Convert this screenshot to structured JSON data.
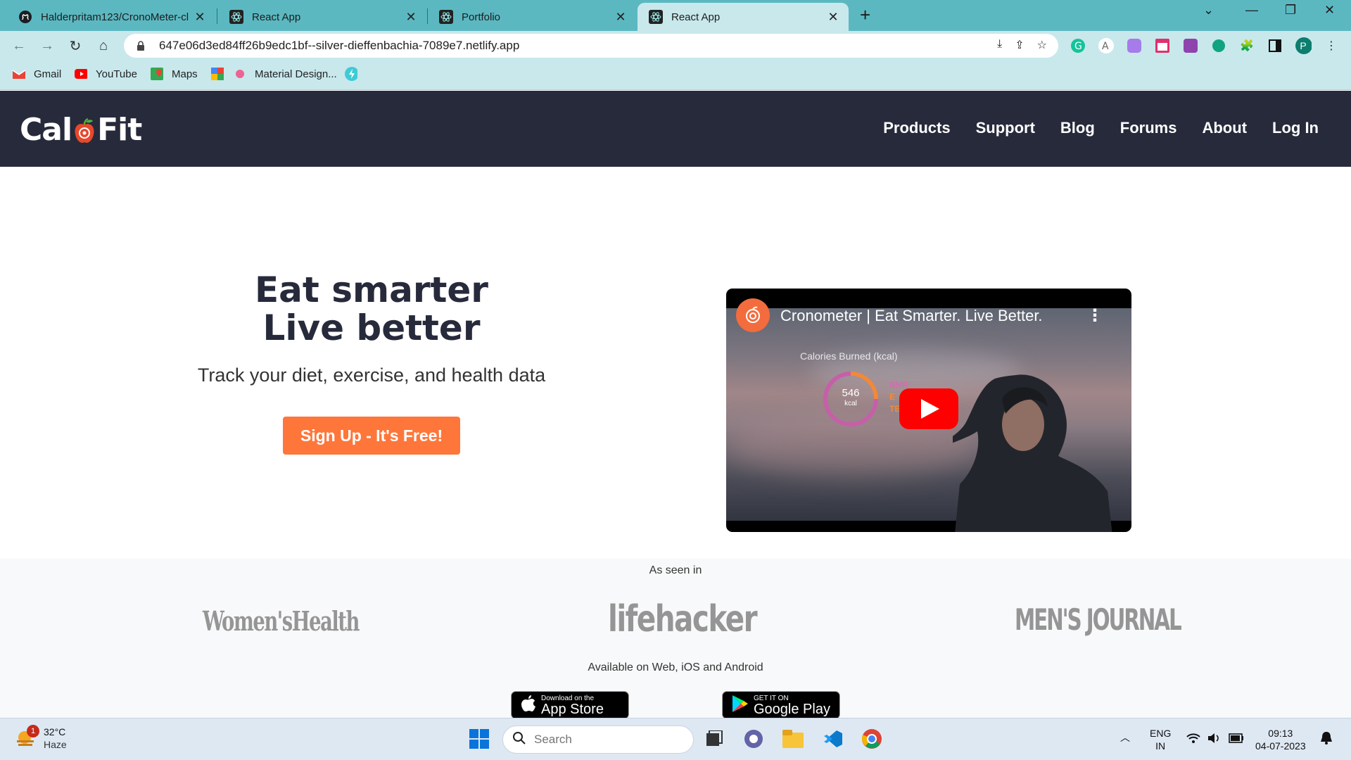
{
  "browser": {
    "tabs": [
      {
        "title": "Halderpritam123/CronoMeter-cl",
        "icon": "github-icon"
      },
      {
        "title": "React App",
        "icon": "react-icon"
      },
      {
        "title": "Portfolio",
        "icon": "github-icon"
      },
      {
        "title": "React App",
        "icon": "react-icon"
      }
    ],
    "new_tab_glyph": "+",
    "url": "647e06d3ed84ff26b9edc1bf--silver-dieffenbachia-7089e7.netlify.app",
    "profile_initial": "P",
    "bookmarks": [
      {
        "label": "Gmail",
        "icon": "gmail-icon"
      },
      {
        "label": "YouTube",
        "icon": "youtube-icon"
      },
      {
        "label": "Maps",
        "icon": "maps-icon"
      },
      {
        "label": "",
        "icon": "apps-icon"
      },
      {
        "label": "Material Design...",
        "icon": "material-design-icon"
      },
      {
        "label": "",
        "icon": "bolt-icon"
      }
    ]
  },
  "site": {
    "logo_left": "Cal",
    "logo_right": "Fit",
    "nav": [
      "Products",
      "Support",
      "Blog",
      "Forums",
      "About",
      "Log In"
    ]
  },
  "hero": {
    "title_line1": "Eat smarter",
    "title_line2": "Live better",
    "subtitle": "Track your diet, exercise, and health data",
    "cta": "Sign Up - It's Free!"
  },
  "video": {
    "title": "Cronometer | Eat Smarter. Live Better.",
    "overlay_label": "Calories Burned (kcal)",
    "kcal_value": "546",
    "kcal_unit": "kcal",
    "legend_bmr": "BMR",
    "legend_e": "E",
    "legend_te": "TE"
  },
  "press": {
    "label": "As seen in",
    "logos": [
      "Women'sHealth",
      "lifehacker",
      "MEN'S JOURNAL"
    ],
    "available": "Available on Web, iOS and Android",
    "app_store_small": "Download on the",
    "app_store_big": "App Store",
    "google_small": "GET IT ON",
    "google_big": "Google Play"
  },
  "taskbar": {
    "weather_temp": "32°C",
    "weather_cond": "Haze",
    "weather_badge": "1",
    "search_placeholder": "Search",
    "lang_line1": "ENG",
    "lang_line2": "IN",
    "time": "09:13",
    "date": "04-07-2023"
  },
  "colors": {
    "header_bg": "#272a3b",
    "cta_bg": "#ff763a",
    "tabstrip": "#5bb8c1",
    "toolbar": "#c8e8ec"
  }
}
